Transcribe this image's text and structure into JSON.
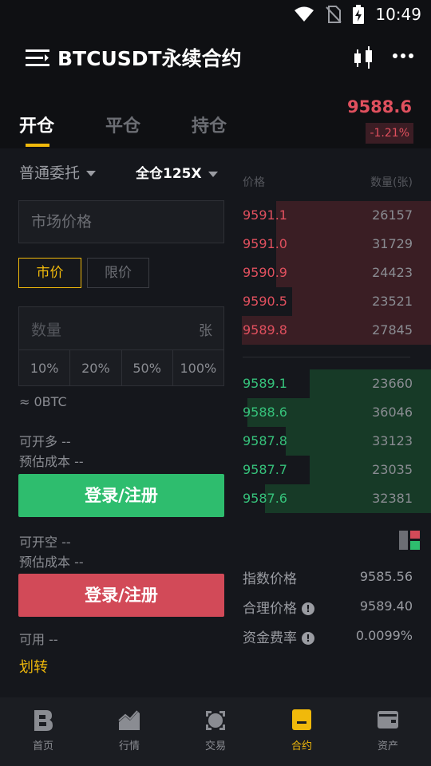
{
  "status_bar": {
    "time": "10:49"
  },
  "header": {
    "title": "BTCUSDT永续合约"
  },
  "tabs": [
    {
      "label": "开仓",
      "active": true
    },
    {
      "label": "平仓",
      "active": false
    },
    {
      "label": "持仓",
      "active": false
    }
  ],
  "ticker": {
    "last_price": "9588.6",
    "change": "-1.21%"
  },
  "order_form": {
    "order_type": "普通委托",
    "margin_mode": "全仓125X",
    "price_placeholder": "市场价格",
    "market_label": "市价",
    "limit_label": "限价",
    "quantity_placeholder": "数量",
    "quantity_unit": "张",
    "percent_options": [
      "10%",
      "20%",
      "50%",
      "100%"
    ],
    "btc_estimate": "≈ 0BTC",
    "long_available": "可开多 --",
    "long_cost": "预估成本 --",
    "long_button": "登录/注册",
    "short_available": "可开空 --",
    "short_cost": "预估成本 --",
    "short_button": "登录/注册",
    "available": "可用  --",
    "transfer": "划转"
  },
  "orderbook": {
    "price_header": "价格",
    "qty_header": "数量(张)",
    "asks": [
      {
        "price": "9591.1",
        "qty": "26157",
        "depth": 0.8
      },
      {
        "price": "9591.0",
        "qty": "31729",
        "depth": 0.8
      },
      {
        "price": "9590.9",
        "qty": "24423",
        "depth": 0.8
      },
      {
        "price": "9590.5",
        "qty": "23521",
        "depth": 0.72
      },
      {
        "price": "9589.8",
        "qty": "27845",
        "depth": 0.98
      }
    ],
    "bids": [
      {
        "price": "9589.1",
        "qty": "23660",
        "depth": 0.63
      },
      {
        "price": "9588.6",
        "qty": "36046",
        "depth": 0.95
      },
      {
        "price": "9587.8",
        "qty": "33123",
        "depth": 0.75
      },
      {
        "price": "9587.7",
        "qty": "23035",
        "depth": 0.63
      },
      {
        "price": "9587.6",
        "qty": "32381",
        "depth": 0.86
      }
    ]
  },
  "indices": [
    {
      "label": "指数价格",
      "value": "9585.56",
      "info": false
    },
    {
      "label": "合理价格",
      "value": "9589.40",
      "info": true
    },
    {
      "label": "资金费率",
      "value": "0.0099%",
      "info": true
    }
  ],
  "bottom_nav": [
    {
      "label": "首页",
      "icon": "home-logo-icon",
      "active": false
    },
    {
      "label": "行情",
      "icon": "market-chart-icon",
      "active": false
    },
    {
      "label": "交易",
      "icon": "trade-icon",
      "active": false
    },
    {
      "label": "合约",
      "icon": "futures-icon",
      "active": true
    },
    {
      "label": "资产",
      "icon": "wallet-icon",
      "active": false
    }
  ],
  "colors": {
    "accent": "#f0b90b",
    "up": "#2ebd6e",
    "down": "#d24a58",
    "background": "#15171c"
  }
}
